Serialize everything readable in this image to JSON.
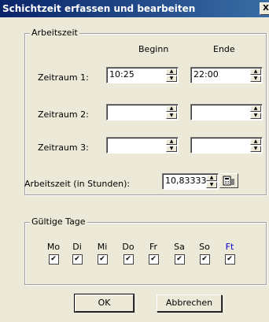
{
  "window": {
    "title": "Schichtzeit erfassen und bearbeiten",
    "close_glyph": "X"
  },
  "arbeitszeit": {
    "legend": "Arbeitszeit",
    "col_begin": "Beginn",
    "col_end": "Ende",
    "rows": [
      {
        "label": "Zeitraum 1:",
        "begin": "10:25",
        "end": "22:00"
      },
      {
        "label": "Zeitraum 2:",
        "begin": "",
        "end": ""
      },
      {
        "label": "Zeitraum 3:",
        "begin": "",
        "end": ""
      }
    ],
    "hours_label": "Arbeitszeit (in Stunden):",
    "hours_value": "10,83333",
    "calc_icon": "calculator-icon"
  },
  "gueltige_tage": {
    "legend": "Gültige Tage",
    "days": [
      {
        "name": "Mo",
        "checked": true,
        "color": "#000000"
      },
      {
        "name": "Di",
        "checked": true,
        "color": "#000000"
      },
      {
        "name": "Mi",
        "checked": true,
        "color": "#000000"
      },
      {
        "name": "Do",
        "checked": true,
        "color": "#000000"
      },
      {
        "name": "Fr",
        "checked": true,
        "color": "#000000"
      },
      {
        "name": "Sa",
        "checked": true,
        "color": "#000000"
      },
      {
        "name": "So",
        "checked": true,
        "color": "#000000"
      },
      {
        "name": "Ft",
        "checked": true,
        "color": "#0000cc"
      }
    ]
  },
  "buttons": {
    "ok": "OK",
    "cancel": "Abbrechen"
  }
}
